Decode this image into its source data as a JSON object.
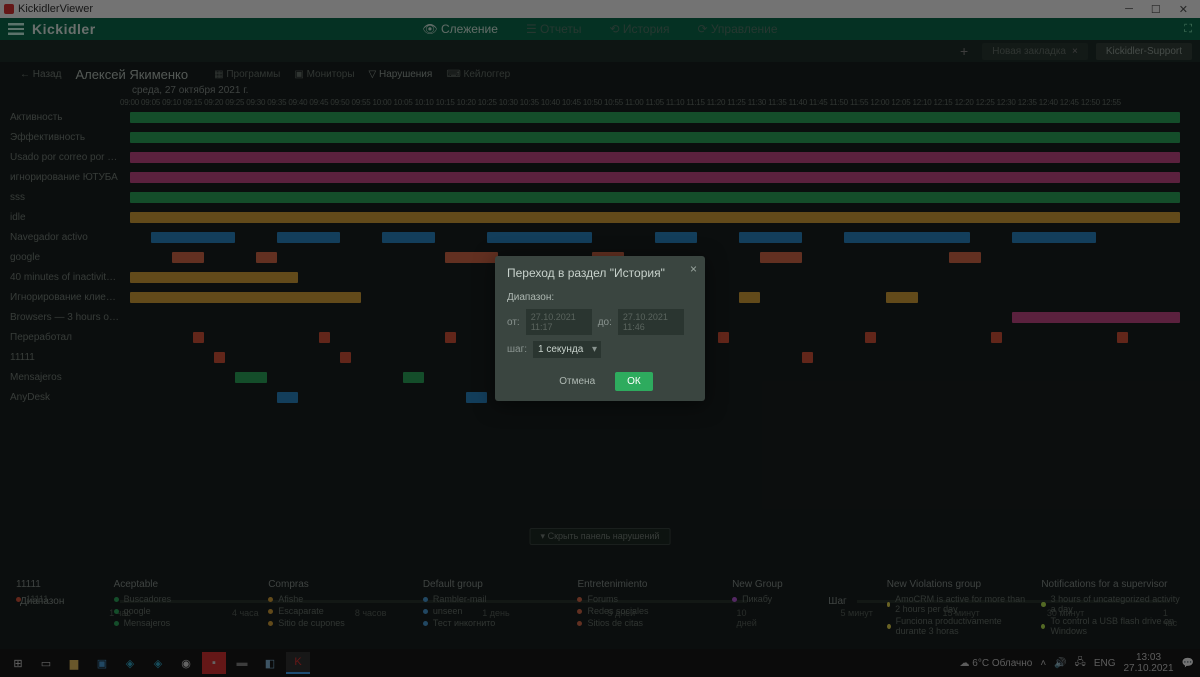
{
  "window_title": "KickidlerViewer",
  "logo": "Kickidler",
  "nav": {
    "track": "Слежение",
    "reports": "Отчеты",
    "history": "История",
    "manage": "Управление"
  },
  "tabs": {
    "new": "Новая закладка",
    "support": "Kickidler-Support"
  },
  "back": "Назад",
  "user": "Алексей Якименко",
  "crumbs": {
    "programs": "Программы",
    "monitors": "Мониторы",
    "violations": "Нарушения",
    "keylogger": "Кейлоггер"
  },
  "date": "среда, 27 октября 2021 г.",
  "times": [
    "09:00",
    "09:05",
    "09:10",
    "09:15",
    "09:20",
    "09:25",
    "09:30",
    "09:35",
    "09:40",
    "09:45",
    "09:50",
    "09:55",
    "10:00",
    "10:05",
    "10:10",
    "10:15",
    "10:20",
    "10:25",
    "10:30",
    "10:35",
    "10:40",
    "10:45",
    "10:50",
    "10:55",
    "11:00",
    "11:05",
    "11:10",
    "11:15",
    "11:20",
    "11:25",
    "11:30",
    "11:35",
    "11:40",
    "11:45",
    "11:50",
    "11:55",
    "12:00",
    "12:05",
    "12:10",
    "12:15",
    "12:20",
    "12:25",
    "12:30",
    "12:35",
    "12:40",
    "12:45",
    "12:50",
    "12:55"
  ],
  "rows": [
    "Активность",
    "Эффективность",
    "Usado por correo por más de ...",
    "игнорирование ЮТУБА",
    "sss",
    "idle",
    "Navegador activo",
    "google",
    "40 minutes of inactivity for an...",
    "Игнорирование клиентов",
    "Browsers — 3 hours of use per...",
    "Переработал",
    "11111",
    "Mensajeros",
    "AnyDesk"
  ],
  "range": {
    "label": "Диапазон",
    "ticks": [
      "1 час",
      "4 часа",
      "8 часов",
      "1 день",
      "5 дней",
      "10 дней"
    ]
  },
  "step": {
    "label": "Шаг",
    "ticks": [
      "5 минут",
      "15 минут",
      "30 минут",
      "1 час"
    ]
  },
  "hide": "Скрыть панель нарушений",
  "sidegroup": {
    "title": "11111",
    "item": "11111"
  },
  "groups": [
    {
      "title": "Aceptable",
      "items": [
        {
          "c": "#2eab5e",
          "t": "Buscadores"
        },
        {
          "c": "#2eab5e",
          "t": "google"
        },
        {
          "c": "#2eab5e",
          "t": "Mensajeros"
        }
      ]
    },
    {
      "title": "Compras",
      "items": [
        {
          "c": "#d9a43a",
          "t": "Afishe"
        },
        {
          "c": "#d9a43a",
          "t": "Escaparate"
        },
        {
          "c": "#d9a43a",
          "t": "Sitio de cupones"
        }
      ]
    },
    {
      "title": "Default group",
      "items": [
        {
          "c": "#4a9ed9",
          "t": "Rambler-mail"
        },
        {
          "c": "#4a9ed9",
          "t": "unseen"
        },
        {
          "c": "#4a9ed9",
          "t": "Тест инкогнито"
        }
      ]
    },
    {
      "title": "Entretenimiento",
      "items": [
        {
          "c": "#d96a4a",
          "t": "Forums"
        },
        {
          "c": "#d96a4a",
          "t": "Redes sociales"
        },
        {
          "c": "#d96a4a",
          "t": "Sitios de citas"
        }
      ]
    },
    {
      "title": "New Group",
      "items": [
        {
          "c": "#b85ad9",
          "t": "Пикабу"
        }
      ]
    },
    {
      "title": "New Violations group",
      "items": [
        {
          "c": "#e8d950",
          "t": "AmoCRM is active for more than 2 hours per day"
        },
        {
          "c": "#e8d950",
          "t": "Funciona productivamente durante 3 horas"
        }
      ]
    },
    {
      "title": "Notifications for a supervisor",
      "items": [
        {
          "c": "#b8e850",
          "t": "3 hours of uncategorized activity a day"
        },
        {
          "c": "#b8e850",
          "t": "To control a USB flash drive on Windows"
        }
      ]
    }
  ],
  "modal": {
    "title": "Переход в раздел \"История\"",
    "range": "Диапазон:",
    "from": "от:",
    "from_v": "27.10.2021 11:17",
    "to": "до:",
    "to_v": "27.10.2021 11:46",
    "step": "шаг:",
    "step_v": "1 секунда",
    "cancel": "Отмена",
    "ok": "ОК"
  },
  "weather": "6°C Облачно",
  "lang": "ENG",
  "clock": {
    "time": "13:03",
    "date": "27.10.2021"
  }
}
